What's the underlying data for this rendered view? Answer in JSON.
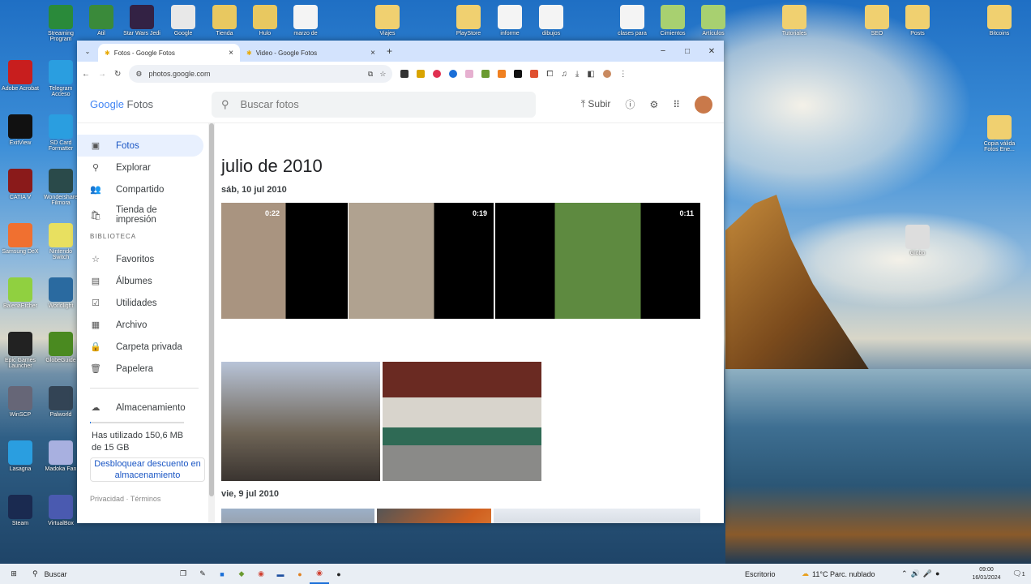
{
  "desktop": {
    "top_icons": [
      "Streaming Program",
      "Atil",
      "Star Wars Jedi",
      "Google",
      "Tienda",
      "Hulo",
      "marzo de",
      "Viajes",
      "PlayStore",
      "informe",
      "dibujos",
      "clases para",
      "Cimientos",
      "Artículos",
      "Tutoriales",
      "SEO",
      "Posts",
      "Bitcoins"
    ],
    "left_icons": [
      "Adobe Acrobat",
      "Telegram Acceso",
      "ExitView",
      "SD Card Formatter",
      "CATIA V",
      "Wondershare Filmora",
      "Samsung DeX",
      "Nintendo Switch",
      "BalenaEtcher",
      "Worldlight",
      "Epic Games Launcher",
      "GlobeGuide",
      "WinSCP",
      "Palworld",
      "Lasagna",
      "Madoka Fan",
      "Steam",
      "VirtualBox"
    ],
    "right_icons": [
      "Copia válida Fotos Ene...",
      "Globo"
    ]
  },
  "browser": {
    "tabs": [
      {
        "label": "Fotos - Google Fotos",
        "active": true
      },
      {
        "label": "Video - Google Fotos",
        "active": false
      }
    ],
    "url": "photos.google.com",
    "window_controls": [
      "−",
      "□",
      "✕"
    ]
  },
  "app": {
    "logo_google": "Google",
    "logo_product": "Fotos",
    "search_placeholder": "Buscar fotos",
    "upload": "Subir"
  },
  "sidebar": {
    "items": [
      {
        "label": "Fotos",
        "icon": "photo-icon",
        "glyph": "▣",
        "active": true
      },
      {
        "label": "Explorar",
        "icon": "search-icon",
        "glyph": "⚲"
      },
      {
        "label": "Compartido",
        "icon": "people-icon",
        "glyph": "👥"
      },
      {
        "label": "Tienda de impresión",
        "icon": "bag-icon",
        "glyph": "🛍"
      }
    ],
    "section": "BIBLIOTECA",
    "library": [
      {
        "label": "Favoritos",
        "icon": "star-icon",
        "glyph": "☆"
      },
      {
        "label": "Álbumes",
        "icon": "album-icon",
        "glyph": "▤"
      },
      {
        "label": "Utilidades",
        "icon": "utilities-icon",
        "glyph": "☑"
      },
      {
        "label": "Archivo",
        "icon": "archive-icon",
        "glyph": "▦"
      },
      {
        "label": "Carpeta privada",
        "icon": "lock-icon",
        "glyph": "🔒"
      },
      {
        "label": "Papelera",
        "icon": "trash-icon",
        "glyph": "🗑"
      }
    ],
    "storage_label": "Almacenamiento",
    "storage_used": "Has utilizado 150,6 MB de 15 GB",
    "storage_used_fraction": 0.01,
    "unlock": "Desbloquear descuento en almacenamiento",
    "privacy": "Privacidad",
    "terms": "Términos"
  },
  "main": {
    "month": "julio de 2010",
    "day1": "sáb, 10 jul 2010",
    "day2": "vie, 9 jul 2010",
    "videos": [
      "0:22",
      "0:19",
      "0:11"
    ]
  },
  "taskbar": {
    "search": "Buscar",
    "desktop": "Escritorio",
    "weather": "11°C  Parc. nublado",
    "time": "09:00",
    "date": "16/01/2024",
    "notifications": "1"
  }
}
